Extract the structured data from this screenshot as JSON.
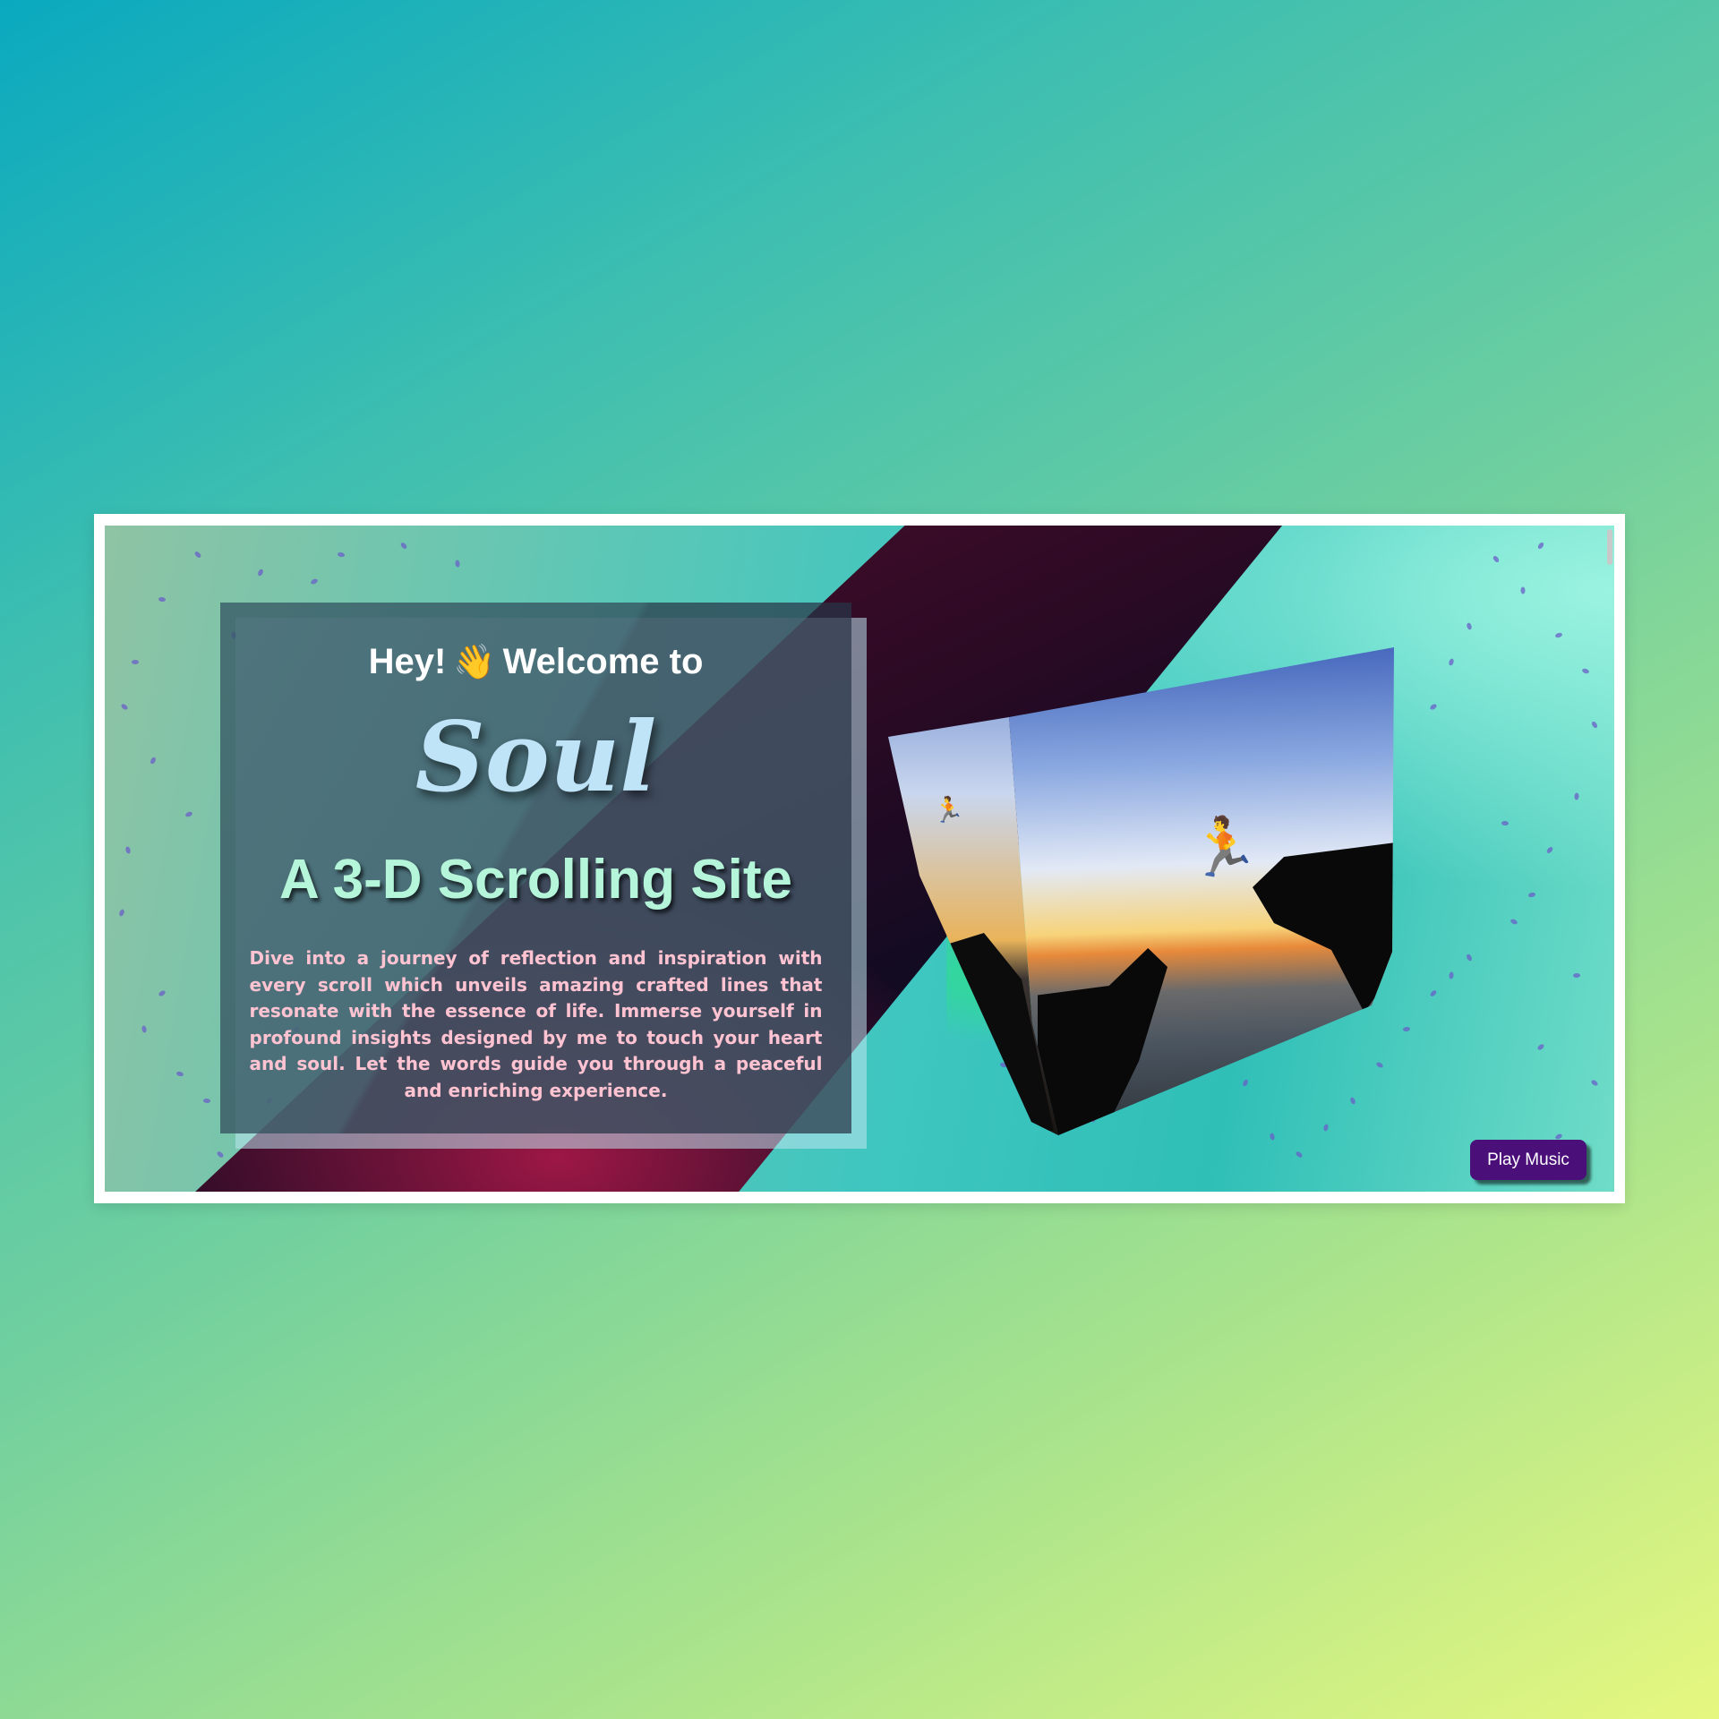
{
  "hero": {
    "greeting_prefix": "Hey!",
    "greeting_suffix": "Welcome to",
    "wave_icon": "👋",
    "brand_name": "Soul",
    "subtitle": "A 3-D Scrolling Site",
    "description": "Dive into a journey of reflection and inspiration with every scroll which unveils amazing crafted lines that resonate with the essence of life. Immerse yourself in profound insights designed by me to touch your heart and soul. Let the words guide you through a peaceful and enriching experience."
  },
  "controls": {
    "play_music_label": "Play Music"
  },
  "icons": {
    "greeting_icon": "waving-hand-icon",
    "jumper_figure": "person-jumping-icon"
  },
  "colors": {
    "brand_text": "#bfe3f7",
    "subtitle_text": "#b5f5d9",
    "description_text": "#ffc3d1",
    "button_background": "#4b0f7a",
    "page_gradient_start": "#0aa9bf",
    "page_gradient_end": "#e6f77f"
  }
}
